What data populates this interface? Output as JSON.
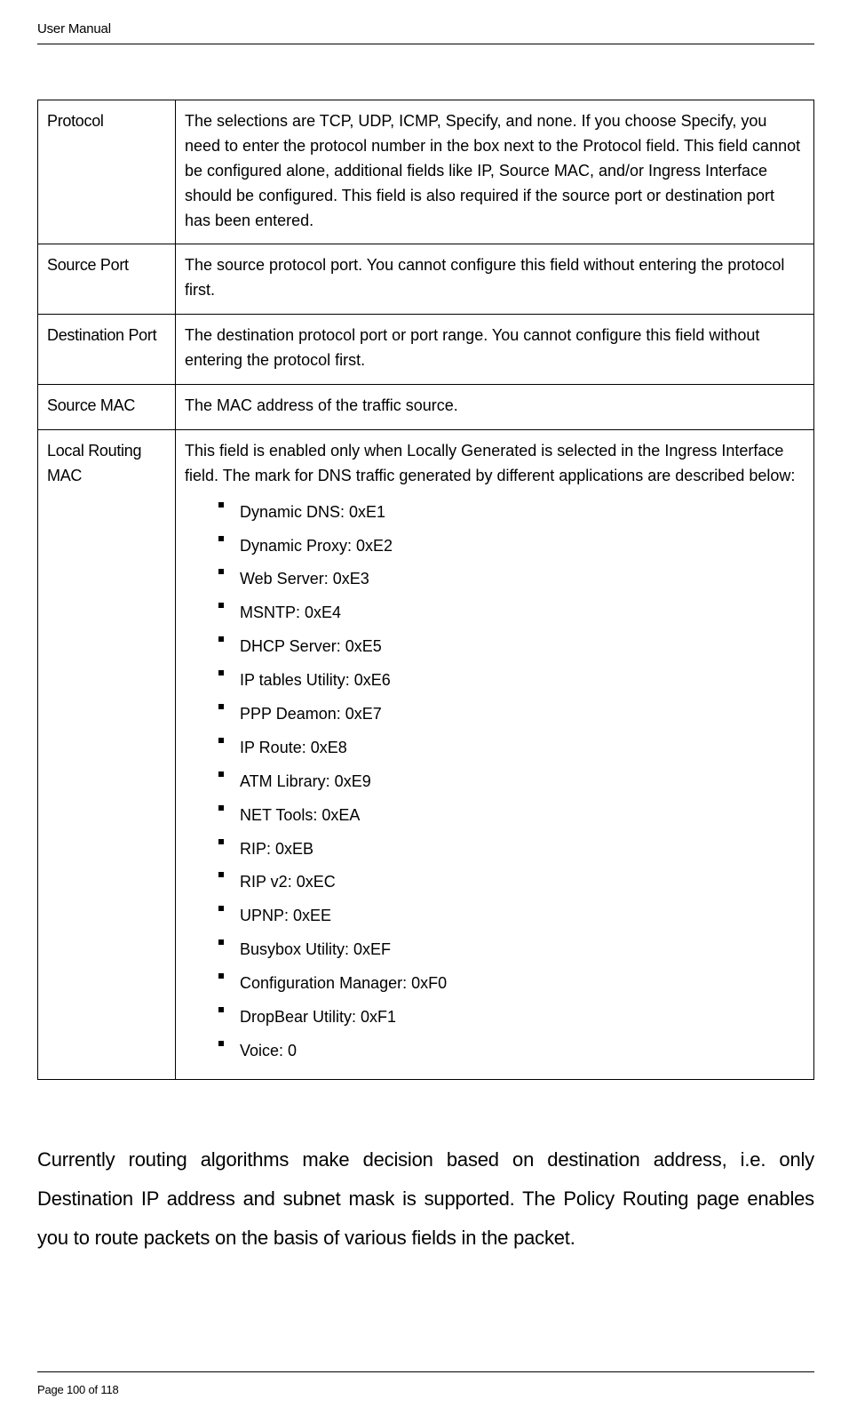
{
  "header": {
    "title": "User Manual"
  },
  "table": {
    "rows": [
      {
        "label": "Protocol",
        "desc": "The selections are TCP, UDP, ICMP, Specify, and none. If you choose Specify, you need to enter the protocol number in the box next to the Protocol field. This field cannot be configured alone, additional fields like IP, Source MAC, and/or Ingress Interface should be configured. This field is also required if the source port or destination port has been entered."
      },
      {
        "label": "Source Port",
        "desc": "The source protocol port. You cannot configure this field without entering the protocol first."
      },
      {
        "label": "Destination Port",
        "desc": "The destination protocol port or port range. You cannot configure this field without entering the protocol first."
      },
      {
        "label": "Source MAC",
        "desc": "The MAC address of the traffic source."
      },
      {
        "label": "Local Routing MAC",
        "desc": "This field is enabled only when Locally Generated is selected in the Ingress Interface field. The mark for DNS traffic generated by different applications are described below:",
        "items": [
          "Dynamic DNS: 0xE1",
          "Dynamic Proxy: 0xE2",
          "Web Server: 0xE3",
          "MSNTP: 0xE4",
          "DHCP Server: 0xE5",
          "IP tables Utility: 0xE6",
          "PPP Deamon: 0xE7",
          "IP Route: 0xE8",
          "ATM Library: 0xE9",
          "NET Tools: 0xEA",
          "RIP: 0xEB",
          "RIP v2: 0xEC",
          "UPNP: 0xEE",
          "Busybox Utility: 0xEF",
          "Configuration Manager: 0xF0",
          "DropBear Utility: 0xF1",
          "Voice: 0"
        ]
      }
    ]
  },
  "body_paragraph": "Currently routing algorithms make decision based on destination address, i.e. only Destination IP address and subnet mask is supported. The Policy Routing page enables you to route packets on the basis of various fields in the packet.",
  "footer": {
    "page_label": "Page",
    "page_num": "100",
    "of_label": "of",
    "total": "118"
  }
}
